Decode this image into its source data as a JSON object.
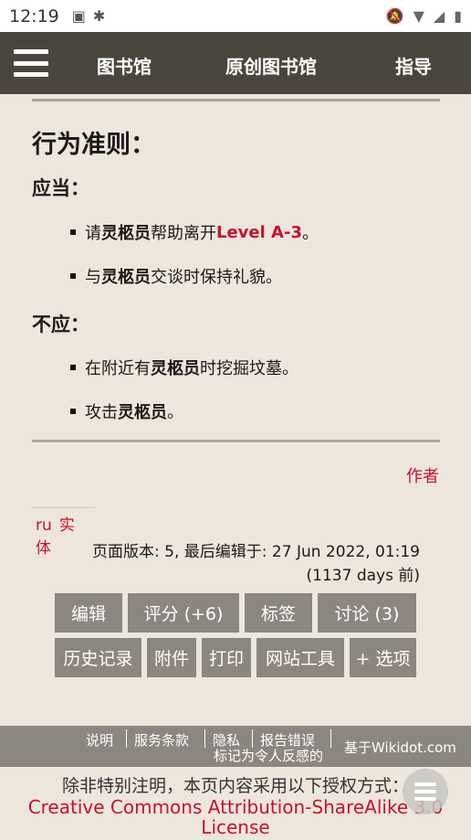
{
  "status_bar": {
    "time": "12:19",
    "icons": [
      "keyboard-icon",
      "bug-icon"
    ],
    "right_icons": [
      "mute-icon",
      "wifi-icon",
      "signal-icon",
      "battery-icon"
    ]
  },
  "nav": {
    "items": [
      "图书馆",
      "原创图书馆",
      "指导"
    ]
  },
  "content": {
    "heading": "行为准则：",
    "should_heading": "应当：",
    "should_items": [
      {
        "pre": "请",
        "bold": "灵柩员",
        "mid": "帮助离开",
        "red": "Level A-3",
        "post": "。"
      },
      {
        "pre": "与",
        "bold": "灵柩员",
        "mid": "交谈时保持礼貌。",
        "red": "",
        "post": ""
      }
    ],
    "shouldnt_heading": "不应：",
    "shouldnt_items": [
      {
        "pre": "在附近有",
        "bold": "灵柩员",
        "mid": "时挖掘坟墓。"
      },
      {
        "pre": "攻击",
        "bold": "灵柩员",
        "mid": "。"
      }
    ],
    "author_link": "作者"
  },
  "tags": [
    "ru",
    "实体"
  ],
  "page_info": {
    "line1": "页面版本: 5, 最后编辑于: 27 Jun 2022, 01:19",
    "line2": "(1137 days 前)"
  },
  "buttons": {
    "edit": "编辑",
    "rate": "评分 (+6)",
    "tags": "标签",
    "discuss": "讨论 (3)",
    "history": "历史记录",
    "files": "附件",
    "print": "打印",
    "site_tools": "网站工具",
    "options": "+ 选项"
  },
  "footer": {
    "help": "说明",
    "terms": "服务条款",
    "privacy": "隐私",
    "report": "报告错误",
    "flag": "标记为令人反感的",
    "powered": "基于Wikidot.com"
  },
  "license": {
    "line1": "除非特别注明，本页内容采用以下授权方式：",
    "cc1": "Creative Commons Attribution-ShareAlike 3.0",
    "cc2": "License"
  }
}
